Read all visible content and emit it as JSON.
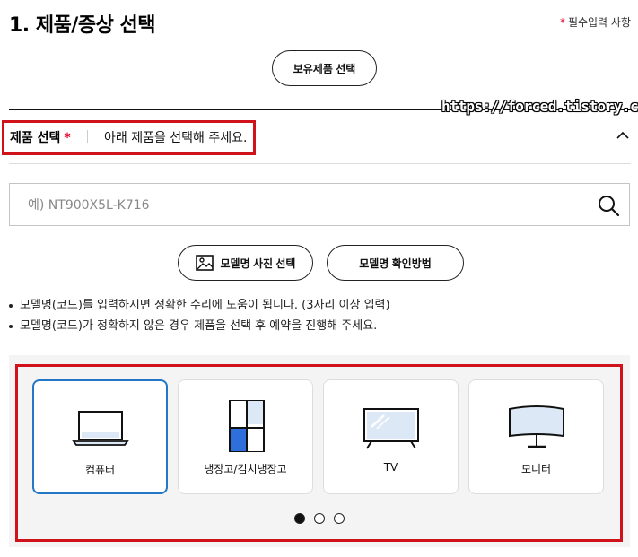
{
  "header": {
    "title": "1. 제품/증상 선택",
    "required_star": "*",
    "required_text": "필수입력 사항"
  },
  "owned_product_button": "보유제품 선택",
  "watermark": "https://forced.tistory.com",
  "product_section": {
    "label": "제품 선택",
    "required_star": "*",
    "hint": "아래 제품을 선택해 주세요."
  },
  "search": {
    "value": "",
    "placeholder": "예) NT900X5L-K716"
  },
  "buttons": {
    "photo_select": "모델명 사진 선택",
    "check_method": "모델명 확인방법"
  },
  "notes": [
    "모델명(코드)를 입력하시면 정확한 수리에 도움이 됩니다. (3자리 이상 입력)",
    "모델명(코드)가 정확하지 않은 경우 제품을 선택 후 예약을 진행해 주세요."
  ],
  "categories": [
    {
      "label": "컴퓨터",
      "icon": "laptop-icon",
      "selected": true
    },
    {
      "label": "냉장고/김치냉장고",
      "icon": "refrigerator-icon",
      "selected": false
    },
    {
      "label": "TV",
      "icon": "tv-icon",
      "selected": false
    },
    {
      "label": "모니터",
      "icon": "monitor-icon",
      "selected": false
    }
  ],
  "pagination": {
    "pages": 3,
    "active": 1
  },
  "colors": {
    "highlight_red": "#d0121b",
    "required_red": "#e4002b",
    "selected_blue": "#2477c6",
    "panel_bg": "#f4f4f4"
  }
}
